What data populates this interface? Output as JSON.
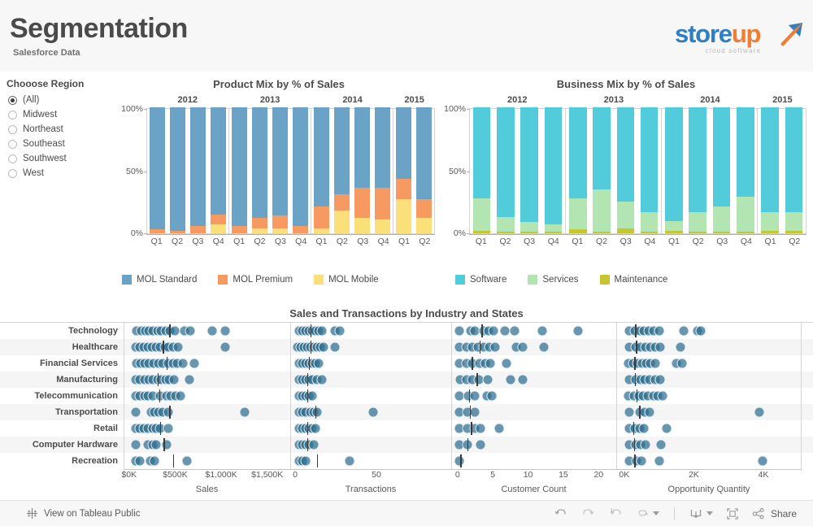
{
  "header": {
    "title": "Segmentation",
    "subtitle": "Salesforce Data",
    "logo": {
      "part1": "store",
      "part2": "up",
      "tagline": "cloud software"
    }
  },
  "filter": {
    "title": "Chooose Region",
    "selected": "(All)",
    "options": [
      "(All)",
      "Midwest",
      "Northeast",
      "Southeast",
      "Southwest",
      "West"
    ]
  },
  "colors": {
    "mol_standard": "#6ba3c7",
    "mol_premium": "#f79a61",
    "mol_mobile": "#fbe07a",
    "software": "#52cbdb",
    "services": "#b2e5b2",
    "maintenance": "#c5c630",
    "dot": "#3d7f9e",
    "brand_blue": "#2f7fc1",
    "brand_orange": "#ef7d33"
  },
  "chart_data": [
    {
      "type": "bar",
      "title": "Product Mix by % of Sales",
      "stacked": true,
      "normalized": true,
      "xlabel": "",
      "ylabel": "",
      "ylim": [
        0,
        100
      ],
      "yticks": [
        "0%",
        "50%",
        "100%"
      ],
      "years": [
        "2012",
        "2013",
        "2014",
        "2015"
      ],
      "quarters_per_year": [
        4,
        4,
        4,
        2
      ],
      "categories": [
        "Q1",
        "Q2",
        "Q3",
        "Q4",
        "Q1",
        "Q2",
        "Q3",
        "Q4",
        "Q1",
        "Q2",
        "Q3",
        "Q4",
        "Q1",
        "Q2"
      ],
      "series": [
        {
          "name": "MOL Mobile",
          "color": "#fbe07a",
          "values": [
            0,
            0,
            0,
            7,
            0,
            4,
            4,
            0,
            4,
            18,
            12,
            11,
            27,
            12
          ]
        },
        {
          "name": "MOL Premium",
          "color": "#f79a61",
          "values": [
            3,
            2,
            6,
            8,
            6,
            8,
            10,
            6,
            17,
            13,
            24,
            25,
            16,
            15
          ]
        },
        {
          "name": "MOL Standard",
          "color": "#6ba3c7",
          "values": [
            97,
            98,
            94,
            85,
            94,
            88,
            86,
            94,
            79,
            69,
            64,
            64,
            57,
            73
          ]
        }
      ],
      "legend": [
        {
          "label": "MOL Standard",
          "color": "#6ba3c7"
        },
        {
          "label": "MOL Premium",
          "color": "#f79a61"
        },
        {
          "label": "MOL Mobile",
          "color": "#fbe07a"
        }
      ]
    },
    {
      "type": "bar",
      "title": "Business Mix by % of Sales",
      "stacked": true,
      "normalized": true,
      "xlabel": "",
      "ylabel": "",
      "ylim": [
        0,
        100
      ],
      "yticks": [
        "0%",
        "50%",
        "100%"
      ],
      "years": [
        "2012",
        "2013",
        "2014",
        "2015"
      ],
      "quarters_per_year": [
        4,
        4,
        4,
        2
      ],
      "categories": [
        "Q1",
        "Q2",
        "Q3",
        "Q4",
        "Q1",
        "Q2",
        "Q3",
        "Q4",
        "Q1",
        "Q2",
        "Q3",
        "Q4",
        "Q1",
        "Q2"
      ],
      "series": [
        {
          "name": "Maintenance",
          "color": "#c5c630",
          "values": [
            2,
            1,
            1,
            1,
            3,
            1,
            4,
            1,
            2,
            1,
            1,
            1,
            2,
            2
          ]
        },
        {
          "name": "Services",
          "color": "#b2e5b2",
          "values": [
            26,
            12,
            8,
            6,
            25,
            34,
            21,
            16,
            8,
            16,
            20,
            28,
            15,
            15
          ]
        },
        {
          "name": "Software",
          "color": "#52cbdb",
          "values": [
            72,
            87,
            91,
            93,
            72,
            65,
            75,
            83,
            90,
            83,
            79,
            71,
            83,
            83
          ]
        }
      ],
      "legend": [
        {
          "label": "Software",
          "color": "#52cbdb"
        },
        {
          "label": "Services",
          "color": "#b2e5b2"
        },
        {
          "label": "Maintenance",
          "color": "#c5c630"
        }
      ]
    },
    {
      "type": "scatter",
      "title": "Sales and Transactions by Industry and States",
      "rows": [
        "Technology",
        "Healthcare",
        "Financial Services",
        "Manufacturing",
        "Telecommunication",
        "Transportation",
        "Retail",
        "Computer Hardware",
        "Recreation"
      ],
      "panels": [
        {
          "axtitle": "Sales",
          "ticks": [
            "$0K",
            "$500K",
            "$1,000K",
            "$1,500K"
          ],
          "tick_values": [
            0,
            500,
            1000,
            1500
          ],
          "xlim": [
            -60,
            1750
          ],
          "medians": [
            430,
            360,
            400,
            300,
            320,
            430,
            330,
            370,
            470
          ],
          "series": [
            {
              "row": "Technology",
              "values": [
                70,
                130,
                170,
                210,
                250,
                300,
                340,
                390,
                440,
                490,
                600,
                660,
                900,
                1040
              ]
            },
            {
              "row": "Healthcare",
              "values": [
                60,
                110,
                150,
                200,
                240,
                290,
                330,
                380,
                420,
                470,
                530,
                1040
              ]
            },
            {
              "row": "Financial Services",
              "values": [
                70,
                120,
                160,
                210,
                260,
                310,
                360,
                420,
                470,
                520,
                580,
                700
              ]
            },
            {
              "row": "Manufacturing",
              "values": [
                60,
                110,
                160,
                210,
                250,
                300,
                340,
                390,
                430,
                480,
                650
              ]
            },
            {
              "row": "Telecommunication",
              "values": [
                60,
                110,
                160,
                200,
                250,
                330,
                400,
                450,
                500,
                550
              ]
            },
            {
              "row": "Transportation",
              "values": [
                60,
                230,
                270,
                310,
                360,
                420,
                1250
              ]
            },
            {
              "row": "Retail",
              "values": [
                60,
                110,
                150,
                200,
                250,
                290,
                330,
                420
              ]
            },
            {
              "row": "Computer Hardware",
              "values": [
                60,
                200,
                250,
                290,
                400
              ]
            },
            {
              "row": "Recreation",
              "values": [
                60,
                110,
                220,
                270,
                620
              ]
            }
          ]
        },
        {
          "axtitle": "Transactions",
          "ticks": [
            "0",
            "50"
          ],
          "tick_values": [
            0,
            50
          ],
          "xlim": [
            -3,
            96
          ],
          "medians": [
            9,
            9,
            8,
            7,
            7,
            12,
            7,
            7,
            13
          ],
          "series": [
            {
              "row": "Technology",
              "values": [
                2,
                4,
                6,
                8,
                10,
                12,
                14,
                16,
                24,
                27
              ]
            },
            {
              "row": "Healthcare",
              "values": [
                1,
                3,
                5,
                7,
                9,
                11,
                13,
                15,
                17,
                24
              ]
            },
            {
              "row": "Financial Services",
              "values": [
                2,
                4,
                6,
                8,
                10,
                12,
                14
              ]
            },
            {
              "row": "Manufacturing",
              "values": [
                2,
                4,
                6,
                8,
                10,
                13,
                16
              ]
            },
            {
              "row": "Telecommunication",
              "values": [
                2,
                4,
                6,
                8,
                10
              ]
            },
            {
              "row": "Transportation",
              "values": [
                2,
                4,
                6,
                9,
                11,
                13,
                48
              ]
            },
            {
              "row": "Retail",
              "values": [
                2,
                4,
                6,
                8,
                10,
                12
              ]
            },
            {
              "row": "Computer Hardware",
              "values": [
                2,
                4,
                6,
                8,
                11
              ]
            },
            {
              "row": "Recreation",
              "values": [
                2,
                4,
                6,
                33
              ]
            }
          ]
        },
        {
          "axtitle": "Customer Count",
          "ticks": [
            "0",
            "5",
            "10",
            "15",
            "20"
          ],
          "tick_values": [
            0,
            5,
            10,
            15,
            20
          ],
          "xlim": [
            -0.9,
            22.5
          ],
          "medians": [
            3.3,
            3.0,
            1.9,
            2.6,
            1.5,
            1.6,
            1.8,
            1.3,
            0.3
          ],
          "series": [
            {
              "row": "Technology",
              "values": [
                0.2,
                1.8,
                2.4,
                3.6,
                4.3,
                5.0,
                6.6,
                8.0,
                12.0,
                17.0
              ]
            },
            {
              "row": "Healthcare",
              "values": [
                0.2,
                1.2,
                2.0,
                2.8,
                3.6,
                4.4,
                5.2,
                8.2,
                9.2,
                12.2
              ]
            },
            {
              "row": "Financial Services",
              "values": [
                0.2,
                1.2,
                2.0,
                3.0,
                3.8,
                4.5,
                6.9
              ]
            },
            {
              "row": "Manufacturing",
              "values": [
                0.3,
                1.2,
                2.0,
                2.9,
                4.2,
                7.4,
                9.2
              ]
            },
            {
              "row": "Telecommunication",
              "values": [
                0.2,
                1.4,
                2.4,
                4.1,
                4.8
              ]
            },
            {
              "row": "Transportation",
              "values": [
                0.2,
                1.3,
                2.3
              ]
            },
            {
              "row": "Retail",
              "values": [
                0.2,
                1.3,
                2.3,
                3.2,
                5.8
              ]
            },
            {
              "row": "Computer Hardware",
              "values": [
                0.2,
                1.3,
                3.2
              ]
            },
            {
              "row": "Recreation",
              "values": [
                0.2
              ]
            }
          ]
        },
        {
          "axtitle": "Opportunity Quantity",
          "ticks": [
            "0K",
            "2K",
            "4K"
          ],
          "tick_values": [
            0,
            2000,
            4000
          ],
          "xlim": [
            -230,
            5100
          ],
          "medians": [
            300,
            320,
            270,
            290,
            330,
            410,
            230,
            260,
            270
          ],
          "series": [
            {
              "row": "Technology",
              "values": [
                120,
                300,
                420,
                560,
                700,
                840,
                1000,
                1700,
                2100,
                2200
              ]
            },
            {
              "row": "Healthcare",
              "values": [
                130,
                320,
                460,
                600,
                740,
                880,
                1020,
                1600
              ]
            },
            {
              "row": "Financial Services",
              "values": [
                110,
                250,
                370,
                490,
                610,
                730,
                870,
                1480,
                1650
              ]
            },
            {
              "row": "Manufacturing",
              "values": [
                130,
                310,
                450,
                580,
                720,
                870,
                1030
              ]
            },
            {
              "row": "Telecommunication",
              "values": [
                110,
                260,
                400,
                530,
                670,
                820,
                960,
                1080
              ]
            },
            {
              "row": "Transportation",
              "values": [
                130,
                430,
                570,
                720,
                3900
              ]
            },
            {
              "row": "Retail",
              "values": [
                120,
                280,
                420,
                550,
                1200
              ]
            },
            {
              "row": "Computer Hardware",
              "values": [
                130,
                310,
                460,
                600,
                1050
              ]
            },
            {
              "row": "Recreation",
              "values": [
                130,
                330,
                480,
                1000,
                4000
              ]
            }
          ]
        }
      ]
    }
  ],
  "footer": {
    "tableau_link": "View on Tableau Public",
    "share_label": "Share",
    "tools": [
      "undo",
      "redo",
      "revert",
      "refresh",
      "pause",
      "download",
      "fullscreen",
      "share"
    ]
  }
}
